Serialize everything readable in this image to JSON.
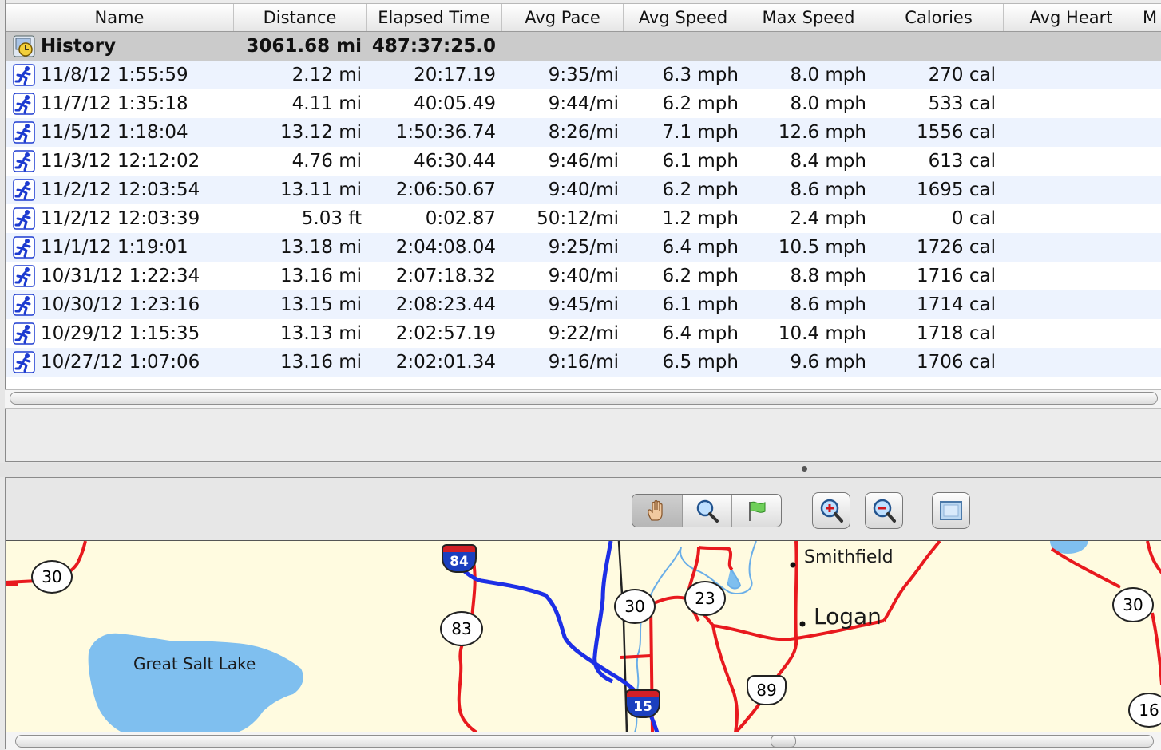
{
  "columns": [
    "Name",
    "Distance",
    "Elapsed Time",
    "Avg Pace",
    "Avg Speed",
    "Max Speed",
    "Calories",
    "Avg Heart",
    "M"
  ],
  "history": {
    "name": "History",
    "distance": "3061.68 mi",
    "elapsed": "487:37:25.0"
  },
  "rows": [
    {
      "name": "11/8/12 1:55:59",
      "distance": "2.12 mi",
      "elapsed": "20:17.19",
      "pace": "9:35/mi",
      "speed": "6.3 mph",
      "max_speed": "8.0 mph",
      "calories": "270 cal"
    },
    {
      "name": "11/7/12 1:35:18",
      "distance": "4.11 mi",
      "elapsed": "40:05.49",
      "pace": "9:44/mi",
      "speed": "6.2 mph",
      "max_speed": "8.0 mph",
      "calories": "533 cal"
    },
    {
      "name": "11/5/12 1:18:04",
      "distance": "13.12 mi",
      "elapsed": "1:50:36.74",
      "pace": "8:26/mi",
      "speed": "7.1 mph",
      "max_speed": "12.6 mph",
      "calories": "1556 cal"
    },
    {
      "name": "11/3/12 12:12:02",
      "distance": "4.76 mi",
      "elapsed": "46:30.44",
      "pace": "9:46/mi",
      "speed": "6.1 mph",
      "max_speed": "8.4 mph",
      "calories": "613 cal"
    },
    {
      "name": "11/2/12 12:03:54",
      "distance": "13.11 mi",
      "elapsed": "2:06:50.67",
      "pace": "9:40/mi",
      "speed": "6.2 mph",
      "max_speed": "8.6 mph",
      "calories": "1695 cal"
    },
    {
      "name": "11/2/12 12:03:39",
      "distance": "5.03 ft",
      "elapsed": "0:02.87",
      "pace": "50:12/mi",
      "speed": "1.2 mph",
      "max_speed": "2.4 mph",
      "calories": "0 cal"
    },
    {
      "name": "11/1/12 1:19:01",
      "distance": "13.18 mi",
      "elapsed": "2:04:08.04",
      "pace": "9:25/mi",
      "speed": "6.4 mph",
      "max_speed": "10.5 mph",
      "calories": "1726 cal"
    },
    {
      "name": "10/31/12 1:22:34",
      "distance": "13.16 mi",
      "elapsed": "2:07:18.32",
      "pace": "9:40/mi",
      "speed": "6.2 mph",
      "max_speed": "8.8 mph",
      "calories": "1716 cal"
    },
    {
      "name": "10/30/12 1:23:16",
      "distance": "13.15 mi",
      "elapsed": "2:08:23.44",
      "pace": "9:45/mi",
      "speed": "6.1 mph",
      "max_speed": "8.6 mph",
      "calories": "1714 cal"
    },
    {
      "name": "10/29/12 1:15:35",
      "distance": "13.13 mi",
      "elapsed": "2:02:57.19",
      "pace": "9:22/mi",
      "speed": "6.4 mph",
      "max_speed": "10.4 mph",
      "calories": "1718 cal"
    },
    {
      "name": "10/27/12 1:07:06",
      "distance": "13.16 mi",
      "elapsed": "2:02:01.34",
      "pace": "9:16/mi",
      "speed": "6.5 mph",
      "max_speed": "9.6 mph",
      "calories": "1706 cal"
    }
  ],
  "toolbar": {
    "tools": [
      "hand-icon",
      "magnifier-icon",
      "flag-icon"
    ],
    "buttons": [
      "zoom-in-icon",
      "zoom-out-icon",
      "fit-view-icon"
    ]
  },
  "map": {
    "places": [
      "Smithfield",
      "Logan",
      "Great Salt Lake"
    ],
    "road_shields": [
      "30",
      "83",
      "30",
      "23",
      "30",
      "16"
    ],
    "interstates": [
      "84",
      "15"
    ],
    "us_route": "89"
  },
  "colors": {
    "row_alt": "#edf3fe",
    "history_row": "#cbcbcb",
    "map_bg": "#fffbe0",
    "road": "#e8191e",
    "track": "#1d2fe6",
    "water": "#7fbfef"
  }
}
